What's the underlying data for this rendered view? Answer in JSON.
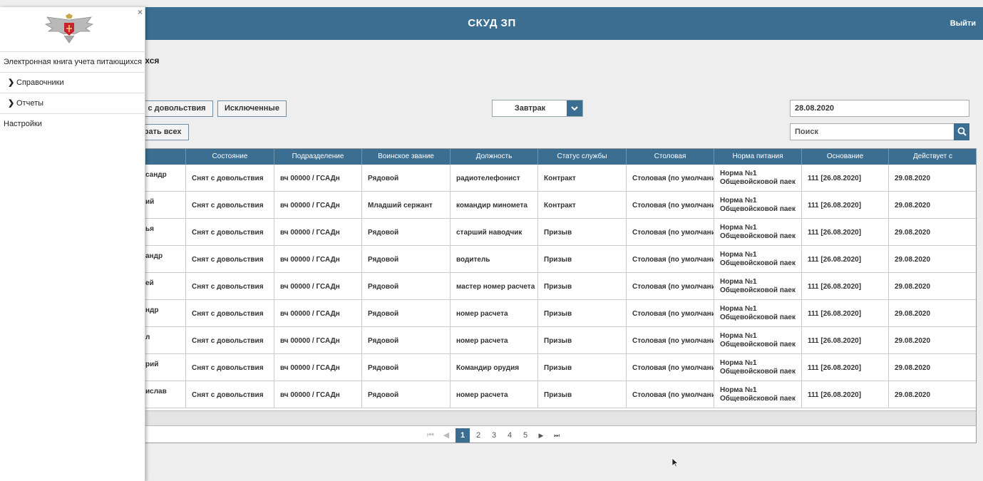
{
  "header": {
    "title": "СКУД ЗП",
    "logout": "Выйти"
  },
  "page": {
    "title_fragment": "ихся"
  },
  "filters": {
    "btn_removed": "ы с довольствия",
    "btn_excluded": "Исключенные",
    "btn_select_all": "брать всех",
    "meal": "Завтрак",
    "date": "28.08.2020",
    "search_placeholder": "Поиск"
  },
  "table": {
    "columns": [
      "о",
      "Состояние",
      "Подразделение",
      "Воинское звание",
      "Должность",
      "Статус службы",
      "Столовая",
      "Норма питания",
      "Основание",
      "Действует с"
    ],
    "rows": [
      {
        "fio": "сандр",
        "state": "Снят с довольствия",
        "unit": "вч 00000 / ГСАДн",
        "rank": "Рядовой",
        "position": "радиотелефонист",
        "status": "Контракт",
        "canteen": "Столовая (по умолчанию)",
        "norm1": "Норма №1",
        "norm2": "Общевойсковой паек",
        "basis": "111 [26.08.2020]",
        "since": "29.08.2020"
      },
      {
        "fio": "ий",
        "state": "Снят с довольствия",
        "unit": "вч 00000 / ГСАДн",
        "rank": "Младший сержант",
        "position": "командир миномета",
        "status": "Контракт",
        "canteen": "Столовая (по умолчанию)",
        "norm1": "Норма №1",
        "norm2": "Общевойсковой паек",
        "basis": "111 [26.08.2020]",
        "since": "29.08.2020"
      },
      {
        "fio": "ья",
        "state": "Снят с довольствия",
        "unit": "вч 00000 / ГСАДн",
        "rank": "Рядовой",
        "position": "старший наводчик",
        "status": "Призыв",
        "canteen": "Столовая (по умолчанию)",
        "norm1": "Норма №1",
        "norm2": "Общевойсковой паек",
        "basis": "111 [26.08.2020]",
        "since": "29.08.2020"
      },
      {
        "fio": "андр",
        "state": "Снят с довольствия",
        "unit": "вч 00000 / ГСАДн",
        "rank": "Рядовой",
        "position": "водитель",
        "status": "Призыв",
        "canteen": "Столовая (по умолчанию)",
        "norm1": "Норма №1",
        "norm2": "Общевойсковой паек",
        "basis": "111 [26.08.2020]",
        "since": "29.08.2020"
      },
      {
        "fio": "ей",
        "state": "Снят с довольствия",
        "unit": "вч 00000 / ГСАДн",
        "rank": "Рядовой",
        "position": "мастер номер расчета",
        "status": "Призыв",
        "canteen": "Столовая (по умолчанию)",
        "norm1": "Норма №1",
        "norm2": "Общевойсковой паек",
        "basis": "111 [26.08.2020]",
        "since": "29.08.2020"
      },
      {
        "fio": "ндр",
        "state": "Снят с довольствия",
        "unit": "вч 00000 / ГСАДн",
        "rank": "Рядовой",
        "position": "номер расчета",
        "status": "Призыв",
        "canteen": "Столовая (по умолчанию)",
        "norm1": "Норма №1",
        "norm2": "Общевойсковой паек",
        "basis": "111 [26.08.2020]",
        "since": "29.08.2020"
      },
      {
        "fio": "л",
        "state": "Снят с довольствия",
        "unit": "вч 00000 / ГСАДн",
        "rank": "Рядовой",
        "position": "номер расчета",
        "status": "Призыв",
        "canteen": "Столовая (по умолчанию)",
        "norm1": "Норма №1",
        "norm2": "Общевойсковой паек",
        "basis": "111 [26.08.2020]",
        "since": "29.08.2020"
      },
      {
        "fio": "рий",
        "state": "Снят с довольствия",
        "unit": "вч 00000 / ГСАДн",
        "rank": "Рядовой",
        "position": "Командир орудия",
        "status": "Призыв",
        "canteen": "Столовая (по умолчанию)",
        "norm1": "Норма №1",
        "norm2": "Общевойсковой паек",
        "basis": "111 [26.08.2020]",
        "since": "29.08.2020"
      },
      {
        "fio": "ислав",
        "state": "Снят с довольствия",
        "unit": "вч 00000 / ГСАДн",
        "rank": "Рядовой",
        "position": "номер расчета",
        "status": "Призыв",
        "canteen": "Столовая (по умолчанию)",
        "norm1": "Норма №1",
        "norm2": "Общевойсковой паек",
        "basis": "111 [26.08.2020]",
        "since": "29.08.2020"
      }
    ]
  },
  "pager": {
    "first": "⏮",
    "prev": "◀",
    "pages": [
      "1",
      "2",
      "3",
      "4",
      "5"
    ],
    "current": "1",
    "next": "▶",
    "last": "⏭"
  },
  "sidebar": {
    "close": "×",
    "items": [
      {
        "label": "Электронная книга учета питающихся"
      },
      {
        "label": "Справочники",
        "chevron": "❯"
      },
      {
        "label": "Отчеты",
        "chevron": "❯"
      },
      {
        "label": "Настройки"
      }
    ]
  },
  "colors": {
    "accent": "#3c6e92",
    "page_bg": "#eeeeee"
  }
}
